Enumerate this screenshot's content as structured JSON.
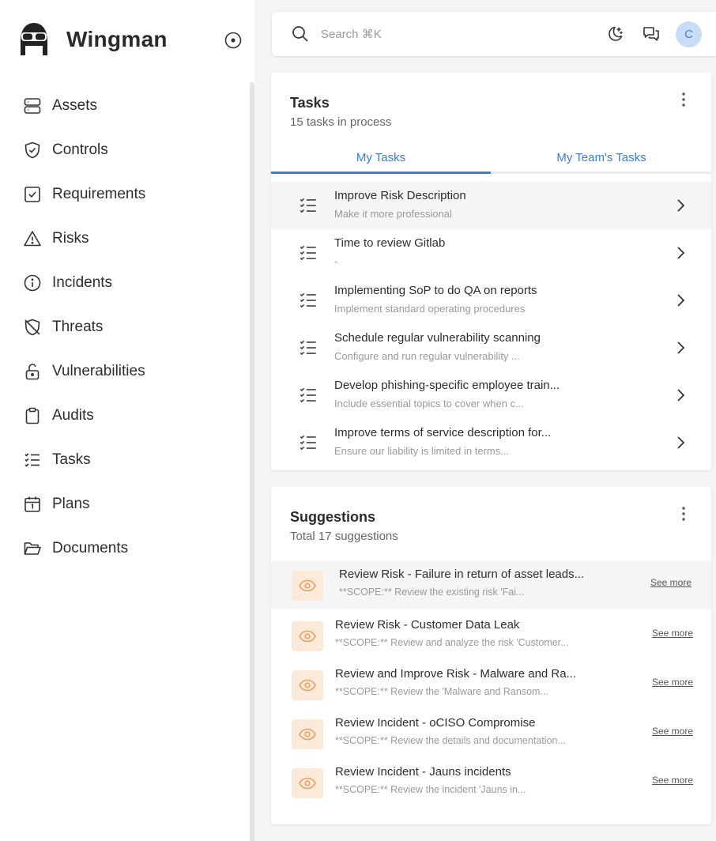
{
  "brand": {
    "name": "Wingman",
    "logo_icon": "pilot-helmet-icon",
    "toggle_icon": "circle-dot-icon"
  },
  "sidebar": {
    "items": [
      {
        "label": "Assets",
        "icon": "server-icon"
      },
      {
        "label": "Controls",
        "icon": "shield-check-icon"
      },
      {
        "label": "Requirements",
        "icon": "checkbox-icon"
      },
      {
        "label": "Risks",
        "icon": "warning-triangle-icon"
      },
      {
        "label": "Incidents",
        "icon": "info-circle-icon"
      },
      {
        "label": "Threats",
        "icon": "shield-off-icon"
      },
      {
        "label": "Vulnerabilities",
        "icon": "unlock-icon"
      },
      {
        "label": "Audits",
        "icon": "clipboard-icon"
      },
      {
        "label": "Tasks",
        "icon": "list-check-icon"
      },
      {
        "label": "Plans",
        "icon": "calendar-icon"
      },
      {
        "label": "Documents",
        "icon": "folder-open-icon"
      }
    ]
  },
  "topbar": {
    "search_placeholder": "Search ⌘K",
    "avatar_initial": "C",
    "colors": {
      "avatar_bg": "#c6dcf7",
      "avatar_text": "#4a7fc7"
    }
  },
  "tasks": {
    "title": "Tasks",
    "subtitle": "15 tasks in process",
    "tabs": [
      {
        "label": "My Tasks",
        "active": true
      },
      {
        "label": "My Team's Tasks",
        "active": false
      }
    ],
    "items": [
      {
        "title": "Improve Risk Description",
        "desc": "Make it more professional"
      },
      {
        "title": "Time to review Gitlab",
        "desc": "-"
      },
      {
        "title": "Implementing SoP to do QA on reports",
        "desc": "Implement standard operating procedures"
      },
      {
        "title": "Schedule regular vulnerability scanning",
        "desc": "Configure and run regular vulnerability ..."
      },
      {
        "title": "Develop phishing-specific employee train...",
        "desc": "Include essential topics to cover when c..."
      },
      {
        "title": "Improve terms of service description for...",
        "desc": "Ensure our liability is limited in terms..."
      }
    ]
  },
  "suggestions": {
    "title": "Suggestions",
    "subtitle": "Total 17 suggestions",
    "see_more_label": "See more",
    "accent": "#e8a05c",
    "items": [
      {
        "title": "Review Risk - Failure in return of asset leads...",
        "desc": "**SCOPE:** Review the existing risk 'Fai..."
      },
      {
        "title": "Review Risk - Customer Data Leak",
        "desc": "**SCOPE:** Review and analyze the risk 'Customer..."
      },
      {
        "title": "Review and Improve Risk - Malware and Ra...",
        "desc": "**SCOPE:** Review the 'Malware and Ransom..."
      },
      {
        "title": "Review Incident - oCISO Compromise",
        "desc": "**SCOPE:** Review the details and documentation..."
      },
      {
        "title": "Review Incident - Jauns incidents",
        "desc": "**SCOPE:** Review the incident 'Jauns in..."
      }
    ]
  },
  "colors": {
    "primary": "#3a7fd5",
    "text": "#2d2d2d",
    "muted": "#9a9a9a"
  }
}
